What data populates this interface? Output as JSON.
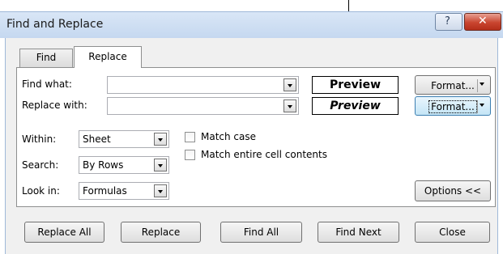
{
  "window": {
    "title": "Find and Replace",
    "help_glyph": "?",
    "close_glyph": "✕"
  },
  "tabs": [
    {
      "label": "Find"
    },
    {
      "label": "Replace"
    }
  ],
  "fields": {
    "find_what": {
      "label": "Find what:",
      "value": ""
    },
    "replace_with": {
      "label": "Replace with:",
      "value": ""
    }
  },
  "preview": {
    "find": "Preview",
    "replace": "Preview"
  },
  "format_buttons": {
    "find": "Format...",
    "replace": "Format..."
  },
  "options": {
    "within": {
      "label": "Within:",
      "value": "Sheet"
    },
    "search": {
      "label": "Search:",
      "value": "By Rows"
    },
    "look_in": {
      "label": "Look in:",
      "value": "Formulas"
    },
    "match_case": {
      "label": "Match case",
      "checked": false
    },
    "match_entire": {
      "label": "Match entire cell contents",
      "checked": false
    },
    "options_button": "Options <<"
  },
  "buttons": {
    "replace_all": "Replace All",
    "replace": "Replace",
    "find_all": "Find All",
    "find_next": "Find Next",
    "close": "Close"
  }
}
